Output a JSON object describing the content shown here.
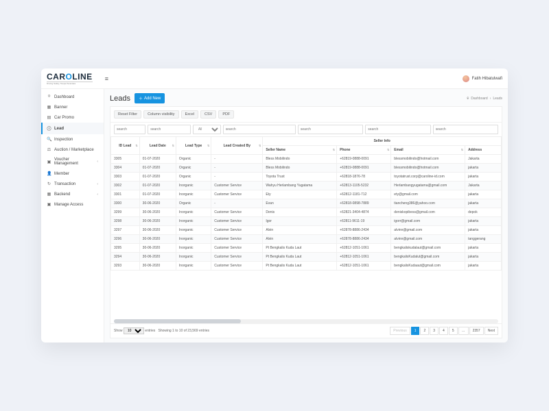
{
  "brand": {
    "name_pre": "CAR",
    "name_o": "O",
    "name_post": "LINE",
    "tagline": "Driving Safely, Tanpa Perantara"
  },
  "user": {
    "name": "Fatih Hibatulwafi"
  },
  "sidebar": {
    "items": [
      {
        "label": "Dashboard",
        "icon": "⌾"
      },
      {
        "label": "Banner",
        "icon": "▦"
      },
      {
        "label": "Car Promo",
        "icon": "▤"
      },
      {
        "label": "Lead",
        "icon": "ⓘ",
        "active": true
      },
      {
        "label": "Inspection",
        "icon": "🔍"
      },
      {
        "label": "Auction / Marketplace",
        "icon": "⚖"
      },
      {
        "label": "Voucher Management",
        "icon": "▣",
        "chev": true
      },
      {
        "label": "Member",
        "icon": "👤"
      },
      {
        "label": "Transaction",
        "icon": "↻",
        "chev": true
      },
      {
        "label": "Backend",
        "icon": "▦",
        "chev": true
      },
      {
        "label": "Manage Access",
        "icon": "▣"
      }
    ]
  },
  "page": {
    "title": "Leads",
    "add_label": "Add New",
    "breadcrumb": {
      "dash_icon": "⌾",
      "dash": "Dashboard",
      "current": "Leads"
    }
  },
  "toolbar": {
    "reset": "Reset Filter",
    "colvis": "Column visibility",
    "excel": "Excel",
    "csv": "CSV",
    "pdf": "PDF"
  },
  "search": {
    "placeholder": "search",
    "all_option": "All"
  },
  "table": {
    "headers": {
      "id_lead": "ID Lead",
      "lead_date": "Lead Date",
      "lead_type": "Lead Type",
      "lead_created_by": "Lead Created By",
      "seller_info": "Seller Info",
      "seller_name": "Seller Name",
      "phone": "Phone",
      "email": "Email",
      "address": "Address"
    },
    "rows": [
      {
        "id": "3305",
        "date": "01-07-2020",
        "type": "Organic",
        "by": "-",
        "seller": "Bless Mobilindo",
        "phone": "+62819-0888-0091",
        "email": "blessmobilindo@hotmail.com",
        "addr": "Jakarta"
      },
      {
        "id": "3304",
        "date": "01-07-2020",
        "type": "Organic",
        "by": "-",
        "seller": "Bless Mobilindo",
        "phone": "+62819-0888-0091",
        "email": "blessmobilindo@hotmail.com",
        "addr": "jakarta"
      },
      {
        "id": "3303",
        "date": "01-07-2020",
        "type": "Organic",
        "by": "-",
        "seller": "Toyota Trust",
        "phone": "+62818-1876-78",
        "email": "toyotatrust.corp@caroline-id.com",
        "addr": "jakarta"
      },
      {
        "id": "3302",
        "date": "01-07-2020",
        "type": "Inorganic",
        "by": "Customer Service",
        "seller": "Wahyu Herlambang Yugatama",
        "phone": "+62813-1105-5232",
        "email": "Herlambangyugatama@gmail.com",
        "addr": "Jakarta"
      },
      {
        "id": "3301",
        "date": "01-07-2020",
        "type": "Inorganic",
        "by": "Customer Service",
        "seller": "Ety",
        "phone": "+62812-1181-712",
        "email": "ety@gmail.com",
        "addr": "jakarta"
      },
      {
        "id": "3300",
        "date": "30-06-2020",
        "type": "Organic",
        "by": "-",
        "seller": "Evan",
        "phone": "+62818-0898-7889",
        "email": "tiancheng386@yahoo.com",
        "addr": "jakarta"
      },
      {
        "id": "3299",
        "date": "30-06-2020",
        "type": "Inorganic",
        "by": "Customer Service",
        "seller": "Denis",
        "phone": "+62821-3404-4874",
        "email": "deniskopibess@gmail.com",
        "addr": "depok"
      },
      {
        "id": "3298",
        "date": "30-06-2020",
        "type": "Inorganic",
        "by": "Customer Service",
        "seller": "Igor",
        "phone": "+62811-9611-19",
        "email": "igorr@gmail.com",
        "addr": "jakarta"
      },
      {
        "id": "3297",
        "date": "30-06-2020",
        "type": "Inorganic",
        "by": "Customer Service",
        "seller": "Alvin",
        "phone": "+62878-8886-2434",
        "email": "alvinn@gmail.com",
        "addr": "jakarta"
      },
      {
        "id": "3296",
        "date": "30-06-2020",
        "type": "Inorganic",
        "by": "Customer Service",
        "seller": "Alvin",
        "phone": "+62878-8886-2434",
        "email": "alvinn@gmail.com",
        "addr": "tanggerang"
      },
      {
        "id": "3295",
        "date": "30-06-2020",
        "type": "Inorganic",
        "by": "Customer Service",
        "seller": "Pt Bengkalis Kuda Laut",
        "phone": "+62812-1051-1061",
        "email": "bengkaliskudalaut@gmail.com",
        "addr": "jakarta"
      },
      {
        "id": "3294",
        "date": "30-06-2020",
        "type": "Inorganic",
        "by": "Customer Service",
        "seller": "Pt Bengkalis Kuda Laut",
        "phone": "+62812-1051-1061",
        "email": "bengkalisKudalut@gmail.com",
        "addr": "jakarta"
      },
      {
        "id": "3293",
        "date": "30-06-2020",
        "type": "Inorganic",
        "by": "Customer Service",
        "seller": "Pt Bengkalis Kuda Laut",
        "phone": "+62812-1051-1061",
        "email": "bengkalisKudaaut@gmail.com",
        "addr": "jakarta"
      }
    ]
  },
  "footer": {
    "show_label": "Show",
    "page_size": "10",
    "entries_label": "entries",
    "info": "Showing 1 to 10 of 23,569 entries",
    "pager": {
      "prev": "Previous",
      "pages": [
        "1",
        "2",
        "3",
        "4",
        "5",
        "…",
        "2357"
      ],
      "next": "Next",
      "active": "1"
    }
  }
}
